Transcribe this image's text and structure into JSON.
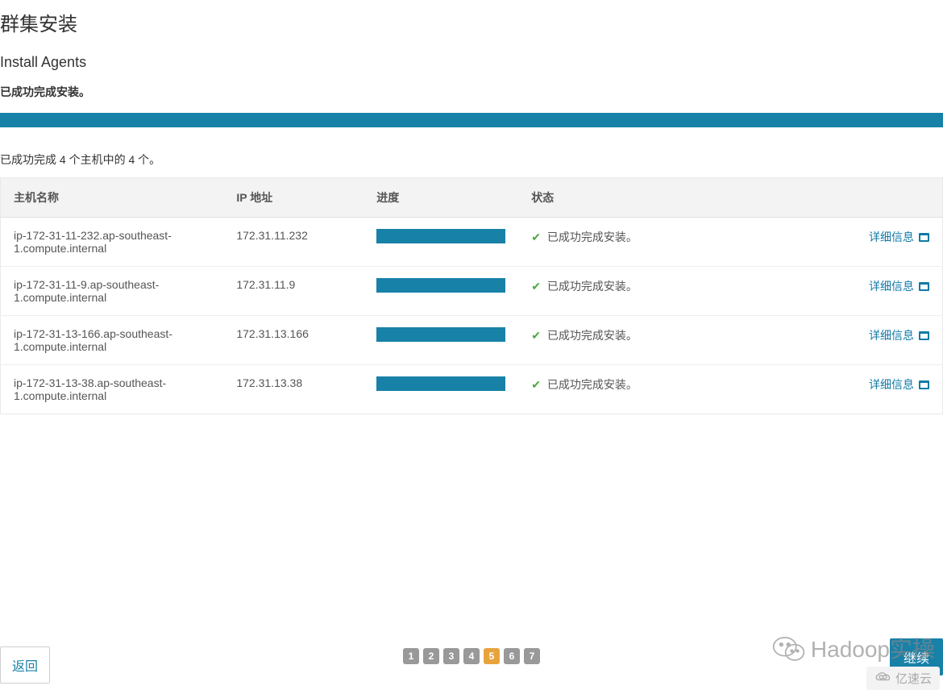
{
  "page": {
    "title": "群集安装",
    "subtitle": "Install Agents",
    "statusMsg": "已成功完成安装。",
    "hostsSummary": "已成功完成 4 个主机中的 4 个。"
  },
  "table": {
    "headers": {
      "hostname": "主机名称",
      "ip": "IP 地址",
      "progress": "进度",
      "status": "状态"
    },
    "rows": [
      {
        "hostname": "ip-172-31-11-232.ap-southeast-1.compute.internal",
        "ip": "172.31.11.232",
        "status": "已成功完成安装。",
        "detail": "详细信息"
      },
      {
        "hostname": "ip-172-31-11-9.ap-southeast-1.compute.internal",
        "ip": "172.31.11.9",
        "status": "已成功完成安装。",
        "detail": "详细信息"
      },
      {
        "hostname": "ip-172-31-13-166.ap-southeast-1.compute.internal",
        "ip": "172.31.13.166",
        "status": "已成功完成安装。",
        "detail": "详细信息"
      },
      {
        "hostname": "ip-172-31-13-38.ap-southeast-1.compute.internal",
        "ip": "172.31.13.38",
        "status": "已成功完成安装。",
        "detail": "详细信息"
      }
    ]
  },
  "pagination": {
    "pages": [
      "1",
      "2",
      "3",
      "4",
      "5",
      "6",
      "7"
    ],
    "current": "5"
  },
  "buttons": {
    "back": "返回",
    "continue": "继续"
  },
  "watermark": {
    "text": "Hadoop实操",
    "brand": "亿速云"
  }
}
